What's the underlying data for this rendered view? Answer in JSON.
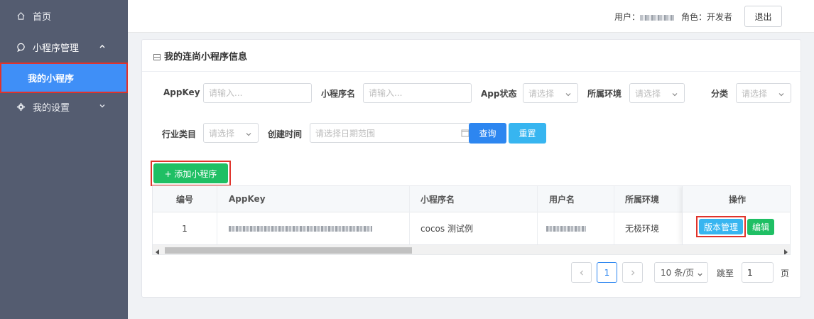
{
  "sidebar": {
    "home": "首页",
    "miniapp_mgmt": "小程序管理",
    "my_miniapps": "我的小程序",
    "my_settings": "我的设置"
  },
  "header": {
    "user_label": "用户：",
    "role_label": "角色：开发者",
    "logout": "退出"
  },
  "card": {
    "title": "我的连尚小程序信息"
  },
  "filters": {
    "appkey_label": "AppKey",
    "appkey_placeholder": "请输入...",
    "name_label": "小程序名",
    "name_placeholder": "请输入...",
    "status_label": "App状态",
    "status_placeholder": "请选择",
    "env_label": "所属环境",
    "env_placeholder": "请选择",
    "category_label": "分类",
    "category_placeholder": "请选择",
    "industry_label": "行业类目",
    "industry_placeholder": "请选择",
    "created_label": "创建时间",
    "created_placeholder": "请选择日期范围",
    "query": "查询",
    "reset": "重置"
  },
  "add_button": "+ 添加小程序",
  "table": {
    "headers": [
      "编号",
      "AppKey",
      "小程序名",
      "用户名",
      "所属环境",
      "操作"
    ],
    "rows": [
      {
        "id": "1",
        "name": "cocos 测试例",
        "env": "无极环境"
      }
    ],
    "actions": {
      "version": "版本管理",
      "edit": "编辑"
    }
  },
  "pagination": {
    "current": "1",
    "page_size": "10 条/页",
    "goto_label": "跳至",
    "goto_value": "1",
    "page_suffix": "页"
  },
  "colors": {
    "sidebar_bg": "#545c70",
    "active_blue": "#3f8ff7",
    "primary": "#2d86f0",
    "info": "#37b5f0",
    "success": "#1fbf64",
    "highlight_red": "#e0332b"
  }
}
